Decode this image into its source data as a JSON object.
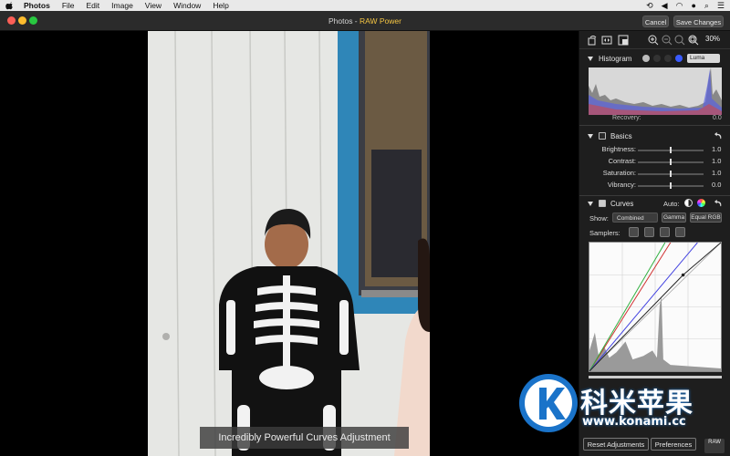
{
  "menubar": {
    "items": [
      "Photos",
      "File",
      "Edit",
      "Image",
      "View",
      "Window",
      "Help"
    ]
  },
  "window": {
    "title_prefix": "Photos - ",
    "title_accent": "RAW Power",
    "cancel_label": "Cancel",
    "save_label": "Save Changes"
  },
  "photo": {
    "caption": "Incredibly Powerful Curves Adjustment"
  },
  "panel": {
    "zoom": "30%",
    "histogram": {
      "title": "Histogram",
      "mode": "Luma",
      "recovery_label": "Recovery:",
      "recovery_value": "0.0",
      "channel_colors": [
        "#bbbbbb",
        "#333333",
        "#333333",
        "#3a5bff"
      ]
    },
    "basics": {
      "title": "Basics",
      "sliders": [
        {
          "label": "Brightness:",
          "value": "1.0",
          "position": 0.5
        },
        {
          "label": "Contrast:",
          "value": "1.0",
          "position": 0.5
        },
        {
          "label": "Saturation:",
          "value": "1.0",
          "position": 0.5
        },
        {
          "label": "Vibrancy:",
          "value": "0.0",
          "position": 0.5
        }
      ]
    },
    "curves": {
      "title": "Curves",
      "auto_label": "Auto:",
      "show_label": "Show:",
      "show_value": "Combined",
      "gamma_label": "Gamma",
      "equal_rgb_label": "Equal RGB",
      "samplers_label": "Samplers:"
    },
    "reset_label": "Reset Adjustments",
    "preferences_label": "Preferences",
    "logo_text": "RAW"
  },
  "watermark": {
    "letter": "K",
    "text": "科米苹果",
    "url": "www.konami.cc"
  },
  "colors": {
    "accent": "#f5c542",
    "watermark_blue": "#1a73c9"
  }
}
